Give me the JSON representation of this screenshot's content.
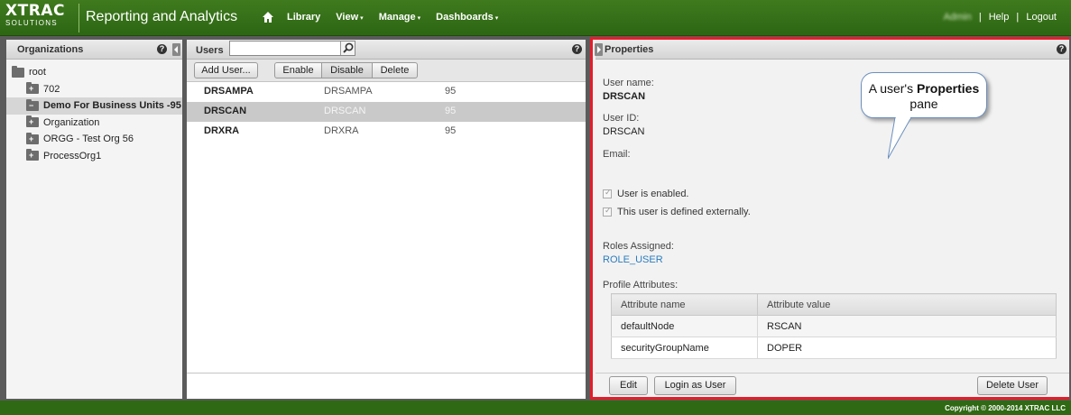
{
  "brand": {
    "line1": "XTRAC",
    "line2": "SOLUTIONS"
  },
  "header": {
    "title": "Reporting and Analytics",
    "nav": [
      {
        "label": "Library",
        "caret": ""
      },
      {
        "label": "View",
        "caret": "▾"
      },
      {
        "label": "Manage",
        "caret": "▾"
      },
      {
        "label": "Dashboards",
        "caret": "▾"
      }
    ],
    "user": "Admin",
    "help": "Help",
    "logout": "Logout",
    "sep": "|"
  },
  "orgs": {
    "title": "Organizations",
    "help_icon": "?",
    "root": "root",
    "items": [
      {
        "label": "702",
        "selected": false
      },
      {
        "label": "Demo For Business Units -95",
        "selected": true
      },
      {
        "label": "Organization",
        "selected": false
      },
      {
        "label": "ORGG - Test Org 56",
        "selected": false
      },
      {
        "label": "ProcessOrg1",
        "selected": false
      }
    ]
  },
  "users": {
    "title": "Users",
    "search_value": "",
    "help_icon": "?",
    "buttons": {
      "add": "Add User...",
      "enable": "Enable",
      "disable": "Disable",
      "delete": "Delete"
    },
    "rows": [
      {
        "name": "DRSAMPA",
        "id": "DRSAMPA",
        "org": "95"
      },
      {
        "name": "DRSCAN",
        "id": "DRSCAN",
        "org": "95"
      },
      {
        "name": "DRXRA",
        "id": "DRXRA",
        "org": "95"
      }
    ]
  },
  "properties": {
    "title": "Properties",
    "help_icon": "?",
    "username_label": "User name:",
    "username": "DRSCAN",
    "userid_label": "User ID:",
    "userid": "DRSCAN",
    "email_label": "Email:",
    "enabled_label": "User is enabled.",
    "external_label": "This user is defined externally.",
    "roles_label": "Roles Assigned:",
    "role": "ROLE_USER",
    "profile_label": "Profile Attributes:",
    "attr_headers": [
      "Attribute name",
      "Attribute value"
    ],
    "attrs": [
      {
        "name": "defaultNode",
        "value": "RSCAN"
      },
      {
        "name": "securityGroupName",
        "value": "DOPER"
      }
    ],
    "buttons": {
      "edit": "Edit",
      "login_as": "Login as User",
      "delete_user": "Delete User"
    }
  },
  "callout": {
    "pre": "A user's",
    "bold": "Properties",
    "post": "pane"
  },
  "footer": {
    "copyright": "Copyright © 2000-2014 XTRAC LLC"
  },
  "colors": {
    "header_green": "#2d6613",
    "highlight_red": "#e51d2a",
    "link_blue": "#2a7cbf"
  }
}
